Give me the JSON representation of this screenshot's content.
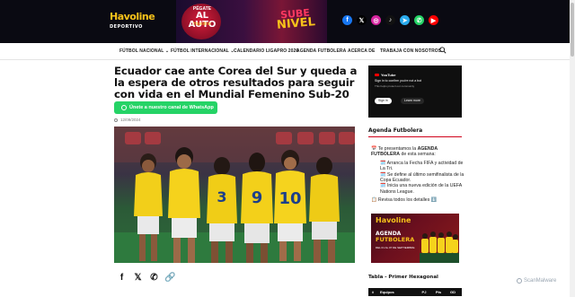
{
  "brand": {
    "logo_text": "Havoline",
    "logo_sub": "DEPORTIVO"
  },
  "banner": {
    "promo_top": "PÉGATE",
    "promo_main": "AL AUTO",
    "promo_logo": "Havoline",
    "promo_right_top": "SUBE",
    "promo_right_bottom": "NIVEL"
  },
  "socials": [
    {
      "name": "facebook-icon",
      "glyph": "f",
      "color": "#1877f2"
    },
    {
      "name": "x-icon",
      "glyph": "𝕏",
      "color": "#000000"
    },
    {
      "name": "instagram-icon",
      "glyph": "◎",
      "color": "#d6249f"
    },
    {
      "name": "tiktok-icon",
      "glyph": "♪",
      "color": "#111111"
    },
    {
      "name": "telegram-icon",
      "glyph": "➤",
      "color": "#2aabee"
    },
    {
      "name": "whatsapp-icon",
      "glyph": "✆",
      "color": "#25d366"
    },
    {
      "name": "youtube-icon",
      "glyph": "▶",
      "color": "#ff0000"
    }
  ],
  "nav": {
    "items": [
      {
        "label": "FÚTBOL NACIONAL",
        "dropdown": true
      },
      {
        "label": "FÚTBOL INTERNACIONAL",
        "dropdown": true
      },
      {
        "label": "CALENDARIO LIGAPRO 2026",
        "dropdown": false
      },
      {
        "label": "AGENDA FUTBOLERA",
        "dropdown": false
      },
      {
        "label": "ACERCA DE",
        "dropdown": false
      },
      {
        "label": "TRABAJA CON NOSOTROS",
        "dropdown": false
      }
    ]
  },
  "article": {
    "title": "Ecuador cae ante Corea del Sur y queda a la espera de otros resultados para seguir con vida en el Mundial Femenino Sub-20",
    "whatsapp_button": "Únete a nuestro canal de WhatsApp",
    "date": "12/09/2024"
  },
  "share": [
    {
      "name": "share-facebook-icon",
      "glyph": "f"
    },
    {
      "name": "share-x-icon",
      "glyph": "𝕏"
    },
    {
      "name": "share-whatsapp-icon",
      "glyph": "✆"
    },
    {
      "name": "share-link-icon",
      "glyph": "🔗"
    }
  ],
  "sidebar": {
    "video": {
      "brand": "YouTube",
      "message": "Sign in to confirm you're not a bot",
      "sub": "This helps protect our community",
      "signin": "Sign in",
      "learn_more": "Learn more"
    },
    "agenda_title": "Agenda Futbolera",
    "agenda_intro_pre": "📅 Te presentamos la ",
    "agenda_intro_bold": "AGENDA FUTBOLERA",
    "agenda_intro_post": " de esta semana:",
    "agenda_items": [
      "🗓️ Arranca la Fecha FIFA y actividad de La Tri.",
      "🗓️ Se define al último semifinalista de la Copa Ecuador.",
      "🗓️ Inicia una nueva edición de la UEFA Nations League."
    ],
    "agenda_more": "📋 Revisa todos los detalles ⬇️",
    "promo": {
      "brand": "Havoline",
      "line1": "AGENDA",
      "line2": "FUTBOLERA",
      "dates": "DEL 01 AL 07 DE SEPTIEMBRE"
    },
    "table_title": "Tabla - Primer Hexagonal",
    "table_headers": [
      "#",
      "Equipos",
      "PJ",
      "Pts",
      "GD"
    ]
  },
  "watermark": "ScanMalware"
}
